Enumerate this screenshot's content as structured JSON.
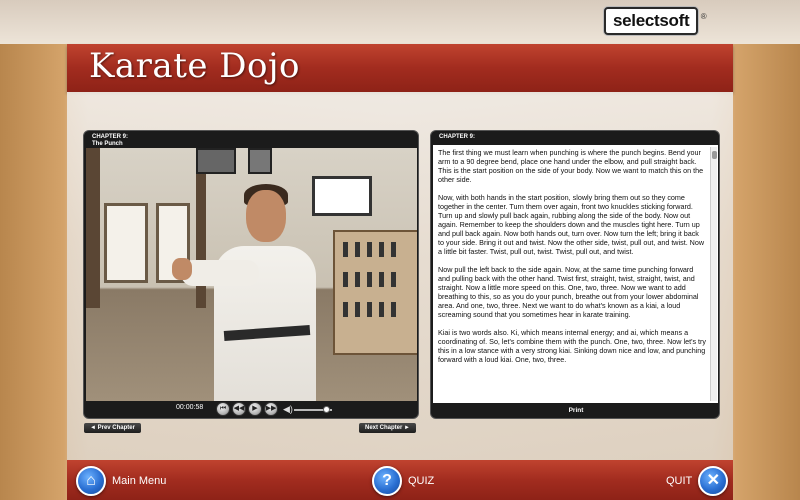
{
  "app": {
    "brand_logo": "selectsoft",
    "brand_mark": "®",
    "title": "Karate Dojo"
  },
  "video_panel": {
    "chapter_label": "CHAPTER 9:",
    "chapter_title": "The Punch",
    "playback_time": "00:00:58",
    "volume_level": 0.85,
    "prev_chapter_label": "◄ Prev Chapter",
    "next_chapter_label": "Next Chapter ►"
  },
  "transcript_panel": {
    "chapter_label": "CHAPTER 9:",
    "paragraphs": [
      "The first thing we must learn when punching is where the punch begins. Bend your arm to a 90 degree bend, place one hand under the elbow, and pull straight back. This is the start position on the side of your body. Now we want to match this on the other side.",
      "Now, with both hands in the start position, slowly bring them out so they come together in the center. Turn them over again, front two knuckles sticking forward. Turn up and slowly pull back again, rubbing along the side of the body. Now out again. Remember to keep the shoulders down and the muscles tight here. Turn up and pull back again. Now both hands out, turn over. Now turn the left; bring it back to your side. Bring it out and twist. Now the other side, twist, pull out, and twist. Now a little bit faster. Twist, pull out, twist. Twist, pull out, and twist.",
      "Now pull the left back to the side again. Now, at the same time punching forward and pulling back with the other hand. Twist first, straight, twist, straight, twist, and straight. Now a little more speed on this. One, two, three. Now we want to add breathing to this, so as you do your punch, breathe out from your lower abdominal area. And one, two, three. Next we want to do what's known as a kiai, a loud screaming sound that you sometimes hear in karate training.",
      "Kiai is two words also. Ki, which means internal energy; and ai, which means a coordinating of. So, let's combine them with the punch. One, two, three. Now let's try this in a low stance with a very strong kiai. Sinking down nice and low, and punching forward with a loud kiai. One, two, three."
    ],
    "print_label": "Print"
  },
  "bottom_nav": {
    "main_menu_label": "Main Menu",
    "quiz_label": "QUIZ",
    "quit_label": "QUIT",
    "quiz_icon_glyph": "?",
    "quit_icon_glyph": "✕",
    "home_icon_glyph": "⌂"
  },
  "icons": [
    "home-icon",
    "help-icon",
    "close-icon",
    "rewind-icon",
    "step-back-icon",
    "play-icon",
    "step-forward-icon",
    "volume-icon"
  ],
  "colors": {
    "banner_red": "#a22c1f",
    "panel_dark": "#1b1b1b",
    "icon_blue": "#2a6fd2"
  }
}
